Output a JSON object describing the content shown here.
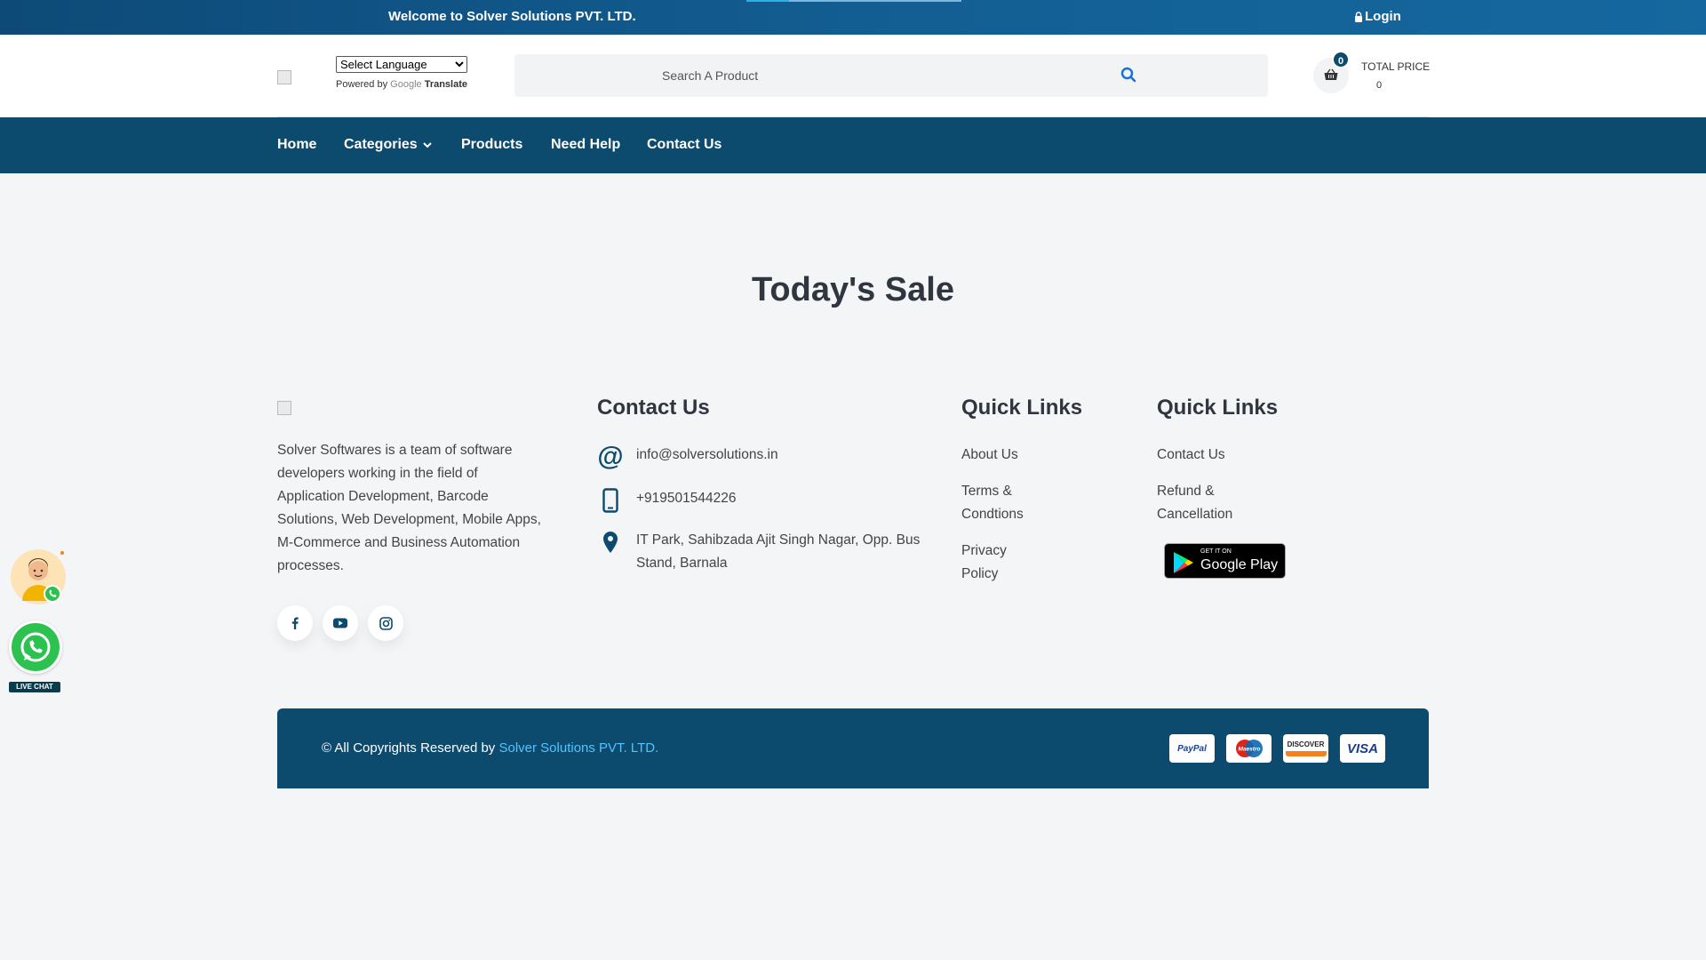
{
  "topbar": {
    "welcome": "Welcome to Solver Solutions PVT. LTD.",
    "login": "Login"
  },
  "header": {
    "language_select": "Select Language",
    "powered_by": "Powered by",
    "google": "Google",
    "translate": "Translate",
    "search_placeholder": "Search A Product",
    "cart_count": "0",
    "total_label": "TOTAL PRICE",
    "total_value": "0"
  },
  "nav": {
    "items": [
      "Home",
      "Categories",
      "Products",
      "Need Help",
      "Contact Us"
    ]
  },
  "main": {
    "sale_title": "Today's Sale"
  },
  "footer": {
    "about": "Solver Softwares is a team of software developers working in the field of Application Development, Barcode Solutions, Web Development, Mobile Apps, M-Commerce and Business Automation processes.",
    "contact_heading": "Contact Us",
    "email": "info@solversolutions.in",
    "phone": "+919501544226",
    "address": "IT Park, Sahibzada Ajit Singh Nagar, Opp. Bus Stand, Barnala",
    "quick_links_1_heading": "Quick Links",
    "quick_links_1": [
      "About Us",
      "Terms & Condtions",
      "Privacy Policy"
    ],
    "quick_links_2_heading": "Quick Links",
    "quick_links_2": [
      "Contact Us",
      "Refund & Cancellation"
    ],
    "google_play_small": "GET IT ON",
    "google_play_big": "Google Play",
    "copyright_prefix": "© All Copyrights Reserved by",
    "copyright_brand": "Solver Solutions PVT. LTD.",
    "payments": [
      "PayPal",
      "Maestro",
      "DISCOVER",
      "VISA"
    ]
  },
  "floating": {
    "live_chat": "LIVE CHAT"
  },
  "colors": {
    "primary": "#0c4a6e",
    "background": "#f4f5f7",
    "accent": "#52c4ff",
    "whatsapp": "#2dc24f"
  }
}
